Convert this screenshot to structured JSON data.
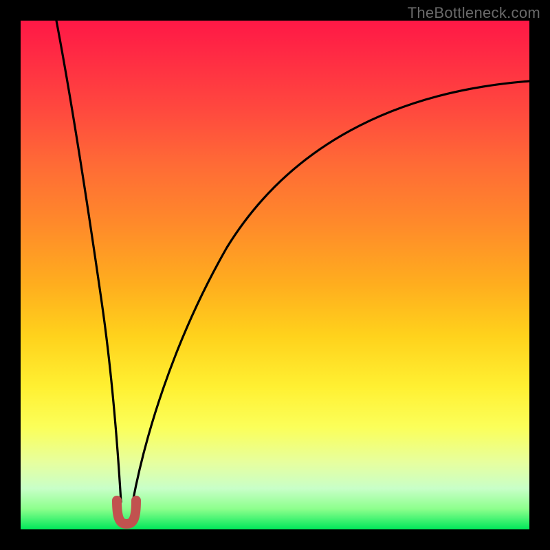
{
  "watermark": "TheBottleneck.com",
  "chart_data": {
    "type": "line",
    "title": "",
    "xlabel": "",
    "ylabel": "",
    "xlim": [
      0,
      100
    ],
    "ylim": [
      0,
      100
    ],
    "grid": false,
    "legend": false,
    "background_gradient": {
      "orientation": "vertical",
      "stops": [
        {
          "pos": 0.0,
          "color": "#ff1846"
        },
        {
          "pos": 0.5,
          "color": "#ffae1e"
        },
        {
          "pos": 0.8,
          "color": "#fbff5a"
        },
        {
          "pos": 1.0,
          "color": "#00e85a"
        }
      ]
    },
    "series": [
      {
        "name": "left-branch",
        "color": "#000000",
        "x": [
          7,
          9,
          11,
          13,
          15,
          17,
          18.8,
          19.8
        ],
        "y": [
          100,
          82,
          64,
          47,
          31,
          16,
          5,
          1
        ]
      },
      {
        "name": "right-branch",
        "color": "#000000",
        "x": [
          22,
          24,
          27,
          31,
          36,
          42,
          50,
          60,
          72,
          86,
          100
        ],
        "y": [
          1,
          8,
          18,
          30,
          42,
          53,
          64,
          73,
          80,
          85,
          88
        ]
      },
      {
        "name": "min-marker",
        "color": "#c1524f",
        "x": [
          19.0,
          19.5,
          20.5,
          21.5,
          22.5,
          23.0
        ],
        "y": [
          4.2,
          1.2,
          0.2,
          0.2,
          1.2,
          4.2
        ]
      }
    ],
    "annotations": []
  }
}
